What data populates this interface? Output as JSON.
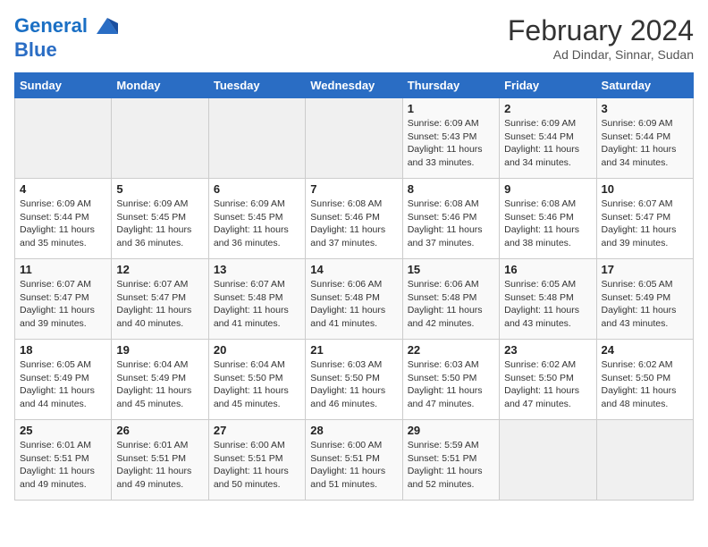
{
  "logo": {
    "line1": "General",
    "line2": "Blue"
  },
  "title": "February 2024",
  "subtitle": "Ad Dindar, Sinnar, Sudan",
  "weekdays": [
    "Sunday",
    "Monday",
    "Tuesday",
    "Wednesday",
    "Thursday",
    "Friday",
    "Saturday"
  ],
  "weeks": [
    [
      {
        "day": "",
        "info": ""
      },
      {
        "day": "",
        "info": ""
      },
      {
        "day": "",
        "info": ""
      },
      {
        "day": "",
        "info": ""
      },
      {
        "day": "1",
        "info": "Sunrise: 6:09 AM\nSunset: 5:43 PM\nDaylight: 11 hours and 33 minutes."
      },
      {
        "day": "2",
        "info": "Sunrise: 6:09 AM\nSunset: 5:44 PM\nDaylight: 11 hours and 34 minutes."
      },
      {
        "day": "3",
        "info": "Sunrise: 6:09 AM\nSunset: 5:44 PM\nDaylight: 11 hours and 34 minutes."
      }
    ],
    [
      {
        "day": "4",
        "info": "Sunrise: 6:09 AM\nSunset: 5:44 PM\nDaylight: 11 hours and 35 minutes."
      },
      {
        "day": "5",
        "info": "Sunrise: 6:09 AM\nSunset: 5:45 PM\nDaylight: 11 hours and 36 minutes."
      },
      {
        "day": "6",
        "info": "Sunrise: 6:09 AM\nSunset: 5:45 PM\nDaylight: 11 hours and 36 minutes."
      },
      {
        "day": "7",
        "info": "Sunrise: 6:08 AM\nSunset: 5:46 PM\nDaylight: 11 hours and 37 minutes."
      },
      {
        "day": "8",
        "info": "Sunrise: 6:08 AM\nSunset: 5:46 PM\nDaylight: 11 hours and 37 minutes."
      },
      {
        "day": "9",
        "info": "Sunrise: 6:08 AM\nSunset: 5:46 PM\nDaylight: 11 hours and 38 minutes."
      },
      {
        "day": "10",
        "info": "Sunrise: 6:07 AM\nSunset: 5:47 PM\nDaylight: 11 hours and 39 minutes."
      }
    ],
    [
      {
        "day": "11",
        "info": "Sunrise: 6:07 AM\nSunset: 5:47 PM\nDaylight: 11 hours and 39 minutes."
      },
      {
        "day": "12",
        "info": "Sunrise: 6:07 AM\nSunset: 5:47 PM\nDaylight: 11 hours and 40 minutes."
      },
      {
        "day": "13",
        "info": "Sunrise: 6:07 AM\nSunset: 5:48 PM\nDaylight: 11 hours and 41 minutes."
      },
      {
        "day": "14",
        "info": "Sunrise: 6:06 AM\nSunset: 5:48 PM\nDaylight: 11 hours and 41 minutes."
      },
      {
        "day": "15",
        "info": "Sunrise: 6:06 AM\nSunset: 5:48 PM\nDaylight: 11 hours and 42 minutes."
      },
      {
        "day": "16",
        "info": "Sunrise: 6:05 AM\nSunset: 5:48 PM\nDaylight: 11 hours and 43 minutes."
      },
      {
        "day": "17",
        "info": "Sunrise: 6:05 AM\nSunset: 5:49 PM\nDaylight: 11 hours and 43 minutes."
      }
    ],
    [
      {
        "day": "18",
        "info": "Sunrise: 6:05 AM\nSunset: 5:49 PM\nDaylight: 11 hours and 44 minutes."
      },
      {
        "day": "19",
        "info": "Sunrise: 6:04 AM\nSunset: 5:49 PM\nDaylight: 11 hours and 45 minutes."
      },
      {
        "day": "20",
        "info": "Sunrise: 6:04 AM\nSunset: 5:50 PM\nDaylight: 11 hours and 45 minutes."
      },
      {
        "day": "21",
        "info": "Sunrise: 6:03 AM\nSunset: 5:50 PM\nDaylight: 11 hours and 46 minutes."
      },
      {
        "day": "22",
        "info": "Sunrise: 6:03 AM\nSunset: 5:50 PM\nDaylight: 11 hours and 47 minutes."
      },
      {
        "day": "23",
        "info": "Sunrise: 6:02 AM\nSunset: 5:50 PM\nDaylight: 11 hours and 47 minutes."
      },
      {
        "day": "24",
        "info": "Sunrise: 6:02 AM\nSunset: 5:50 PM\nDaylight: 11 hours and 48 minutes."
      }
    ],
    [
      {
        "day": "25",
        "info": "Sunrise: 6:01 AM\nSunset: 5:51 PM\nDaylight: 11 hours and 49 minutes."
      },
      {
        "day": "26",
        "info": "Sunrise: 6:01 AM\nSunset: 5:51 PM\nDaylight: 11 hours and 49 minutes."
      },
      {
        "day": "27",
        "info": "Sunrise: 6:00 AM\nSunset: 5:51 PM\nDaylight: 11 hours and 50 minutes."
      },
      {
        "day": "28",
        "info": "Sunrise: 6:00 AM\nSunset: 5:51 PM\nDaylight: 11 hours and 51 minutes."
      },
      {
        "day": "29",
        "info": "Sunrise: 5:59 AM\nSunset: 5:51 PM\nDaylight: 11 hours and 52 minutes."
      },
      {
        "day": "",
        "info": ""
      },
      {
        "day": "",
        "info": ""
      }
    ]
  ]
}
